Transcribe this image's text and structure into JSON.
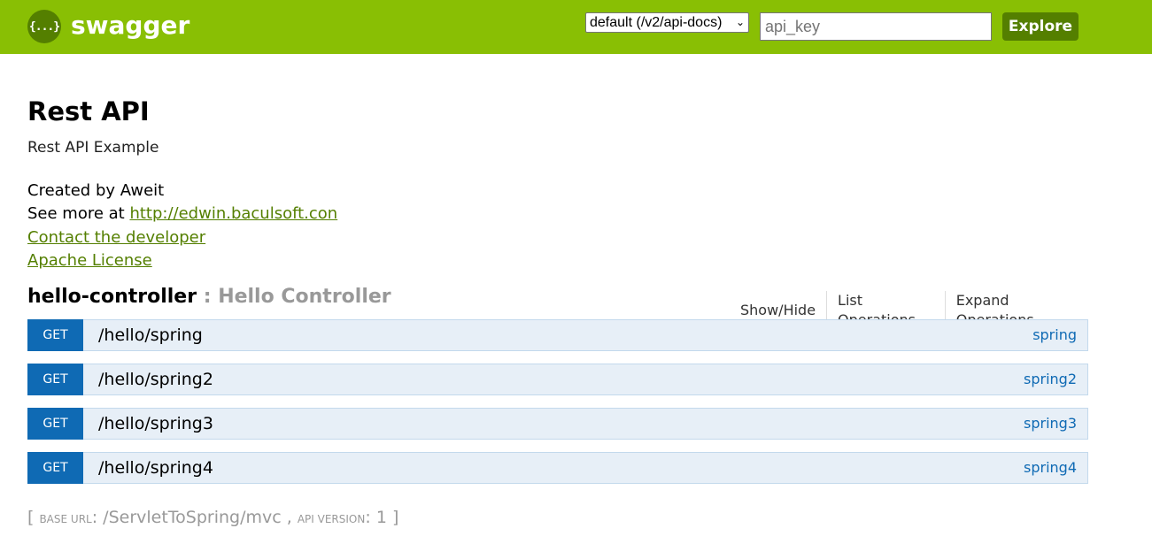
{
  "header": {
    "logo_glyph": "{...}",
    "logo_text": "swagger",
    "spec_select_value": "default (/v2/api-docs)",
    "api_key_placeholder": "api_key",
    "explore_label": "Explore",
    "background_color": "#89bf04"
  },
  "info": {
    "title": "Rest API",
    "description": "Rest API Example",
    "created_by": "Created by Aweit",
    "see_more_prefix": "See more at ",
    "see_more_link": "http://edwin.baculsoft.con",
    "contact_link": "Contact the developer",
    "license_link": "Apache License"
  },
  "resource": {
    "name": "hello-controller",
    "separator": " : ",
    "description": "Hello Controller",
    "actions": [
      "Show/Hide",
      "List Operations",
      "Expand Operations"
    ]
  },
  "operations": [
    {
      "method": "GET",
      "path": "/hello/spring",
      "nickname": "spring"
    },
    {
      "method": "GET",
      "path": "/hello/spring2",
      "nickname": "spring2"
    },
    {
      "method": "GET",
      "path": "/hello/spring3",
      "nickname": "spring3"
    },
    {
      "method": "GET",
      "path": "/hello/spring4",
      "nickname": "spring4"
    }
  ],
  "footer": {
    "open_bracket": "[ ",
    "base_url_label": "base url",
    "base_url_sep": ": ",
    "base_url": "/ServletToSpring/mvc",
    "comma": " , ",
    "api_version_label": "api version",
    "api_version_sep": ": ",
    "api_version": "1",
    "close_bracket": " ]"
  },
  "colors": {
    "get_method": "#0f6ab4",
    "op_background": "#e7eff7",
    "link": "#547f00"
  }
}
